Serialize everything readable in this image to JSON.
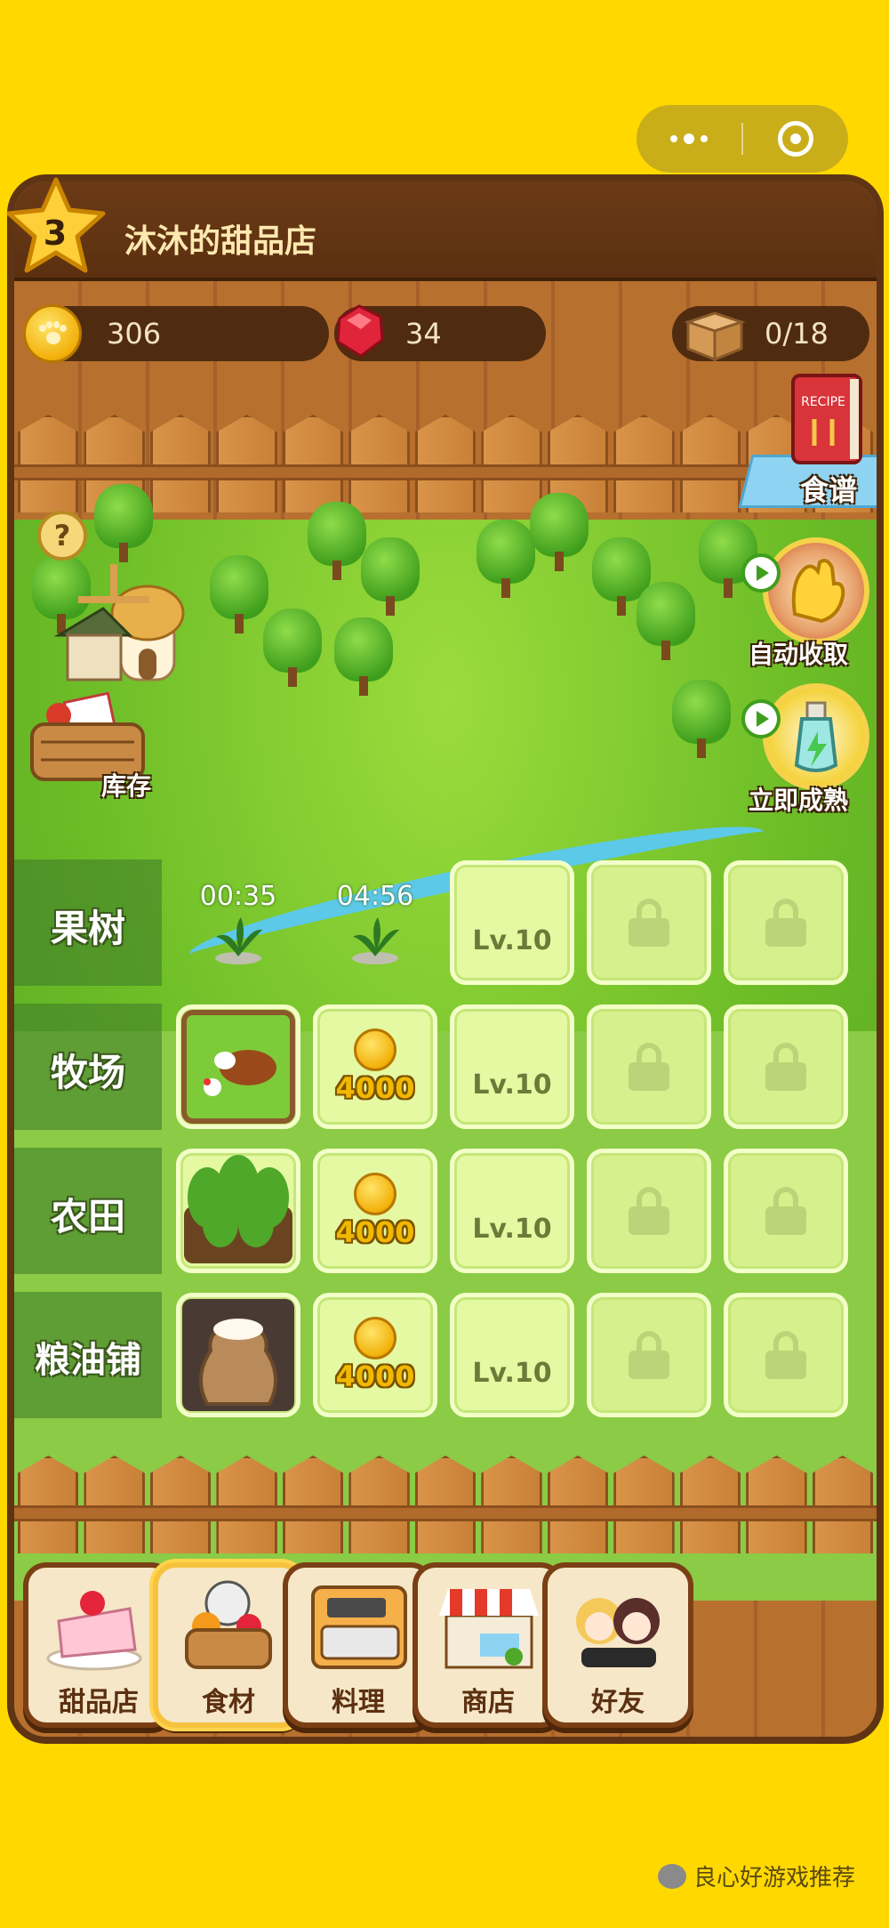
{
  "capsule": {
    "more_icon": "more-dots-icon",
    "close_icon": "target-icon"
  },
  "header": {
    "level": "3",
    "shop_name": "沐沐的甜品店"
  },
  "currency": {
    "coins": "306",
    "gems": "34",
    "storage": "0/18"
  },
  "side_buttons": {
    "recipe": "食谱",
    "auto_collect": "自动收取",
    "instant_mature": "立即成熟",
    "inventory": "库存",
    "help": "?"
  },
  "rows": [
    {
      "label": "果树",
      "cells": [
        {
          "type": "timer",
          "text": "00:35"
        },
        {
          "type": "timer",
          "text": "04:56"
        },
        {
          "type": "level",
          "text": "Lv.10"
        },
        {
          "type": "locked"
        },
        {
          "type": "locked"
        }
      ]
    },
    {
      "label": "牧场",
      "cells": [
        {
          "type": "image",
          "icon": "ranch-icon"
        },
        {
          "type": "price",
          "text": "4000"
        },
        {
          "type": "level",
          "text": "Lv.10"
        },
        {
          "type": "locked"
        },
        {
          "type": "locked"
        }
      ]
    },
    {
      "label": "农田",
      "cells": [
        {
          "type": "image",
          "icon": "field-icon"
        },
        {
          "type": "price",
          "text": "4000"
        },
        {
          "type": "level",
          "text": "Lv.10"
        },
        {
          "type": "locked"
        },
        {
          "type": "locked"
        }
      ]
    },
    {
      "label": "粮油铺",
      "cells": [
        {
          "type": "image",
          "icon": "flour-sack-icon"
        },
        {
          "type": "price",
          "text": "4000"
        },
        {
          "type": "level",
          "text": "Lv.10"
        },
        {
          "type": "locked"
        },
        {
          "type": "locked"
        }
      ]
    }
  ],
  "nav": [
    {
      "label": "甜品店",
      "icon": "cake-icon"
    },
    {
      "label": "食材",
      "icon": "basket-icon",
      "active": true
    },
    {
      "label": "料理",
      "icon": "oven-icon"
    },
    {
      "label": "商店",
      "icon": "store-icon"
    },
    {
      "label": "好友",
      "icon": "friends-icon"
    }
  ],
  "watermark": "良心好游戏推荐",
  "colors": {
    "background": "#ffd800",
    "wood": "#7d4a22",
    "grass": "#6cbc27",
    "cell": "#e4f9a2",
    "gold": "#f0b800"
  }
}
